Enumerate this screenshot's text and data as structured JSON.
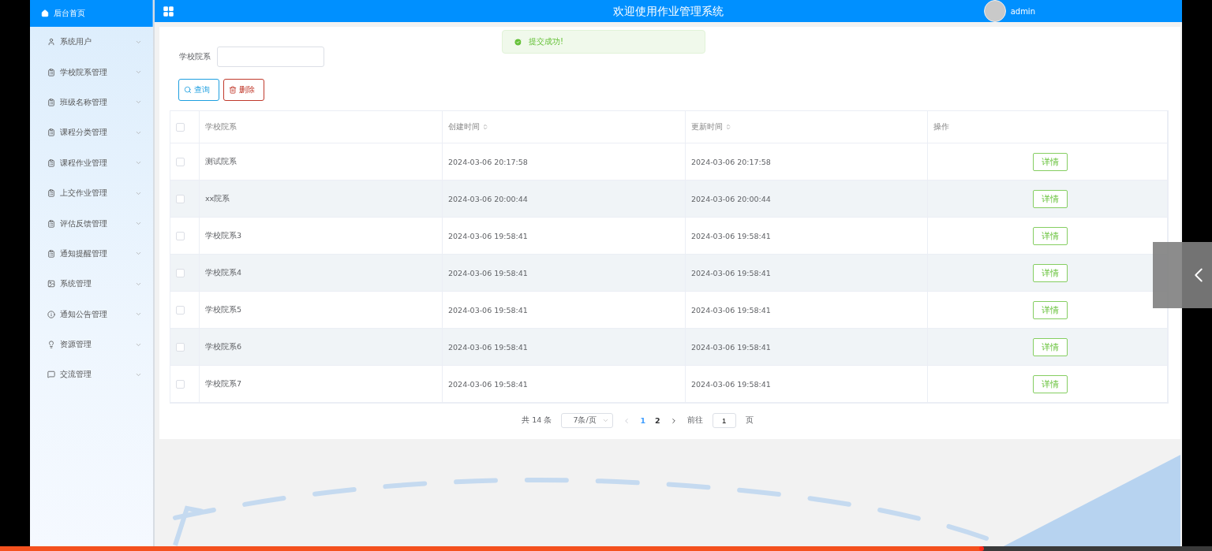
{
  "sidebar": {
    "home": "后台首页",
    "items": [
      {
        "label": "系统用户"
      },
      {
        "label": "学校院系管理"
      },
      {
        "label": "班级名称管理"
      },
      {
        "label": "课程分类管理"
      },
      {
        "label": "课程作业管理"
      },
      {
        "label": "上交作业管理"
      },
      {
        "label": "评估反馈管理"
      },
      {
        "label": "通知提醒管理"
      },
      {
        "label": "系统管理"
      },
      {
        "label": "通知公告管理"
      },
      {
        "label": "资源管理"
      },
      {
        "label": "交流管理"
      }
    ]
  },
  "header": {
    "title": "欢迎使用作业管理系统",
    "user": "admin"
  },
  "toast": {
    "message": "提交成功!"
  },
  "search": {
    "label": "学校院系"
  },
  "buttons": [
    {
      "label": "查询",
      "kind": "search"
    },
    {
      "label": "删除",
      "kind": "delete"
    }
  ],
  "table": {
    "all_checked": false,
    "columns": [
      {
        "label": "学校院系",
        "sortable": false
      },
      {
        "label": "创建时间",
        "sortable": true
      },
      {
        "label": "更新时间",
        "sortable": true
      },
      {
        "label": "操作",
        "sortable": false
      }
    ],
    "rows": [
      {
        "name": "测试院系",
        "created": "2024-03-06 20:17:58",
        "updated": "2024-03-06 20:17:58",
        "action": "详情",
        "checked": false
      },
      {
        "name": "xx院系",
        "created": "2024-03-06 20:00:44",
        "updated": "2024-03-06 20:00:44",
        "action": "详情",
        "checked": false
      },
      {
        "name": "学校院系3",
        "created": "2024-03-06 19:58:41",
        "updated": "2024-03-06 19:58:41",
        "action": "详情",
        "checked": false
      },
      {
        "name": "学校院系4",
        "created": "2024-03-06 19:58:41",
        "updated": "2024-03-06 19:58:41",
        "action": "详情",
        "checked": false
      },
      {
        "name": "学校院系5",
        "created": "2024-03-06 19:58:41",
        "updated": "2024-03-06 19:58:41",
        "action": "详情",
        "checked": false
      },
      {
        "name": "学校院系6",
        "created": "2024-03-06 19:58:41",
        "updated": "2024-03-06 19:58:41",
        "action": "详情",
        "checked": false
      },
      {
        "name": "学校院系7",
        "created": "2024-03-06 19:58:41",
        "updated": "2024-03-06 19:58:41",
        "action": "详情",
        "checked": false
      }
    ]
  },
  "pagination": {
    "total": "共 14 条",
    "page_size": "7条/页",
    "pages": [
      {
        "label": "1",
        "selected": true
      },
      {
        "label": "2",
        "selected": false
      }
    ],
    "goto_label": "前往",
    "goto_value": "1",
    "goto_suffix": "页"
  },
  "player": {
    "level": 0.81
  }
}
